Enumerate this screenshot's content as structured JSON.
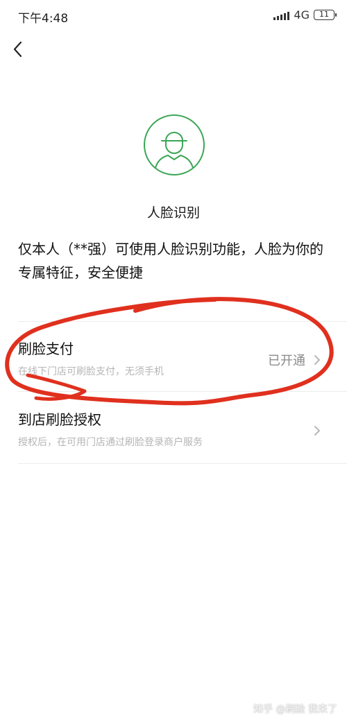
{
  "status_bar": {
    "time": "下午4:48",
    "network": "4G",
    "battery": "11"
  },
  "header": {
    "back_icon": "chevron-left-icon"
  },
  "feature": {
    "title": "人脸识别",
    "avatar_icon": "face-avatar-icon",
    "accent_color": "#3aa655",
    "description": "仅本人（**强）可使用人脸识别功能，人脸为你的专属特征，安全便捷"
  },
  "items": [
    {
      "title": "刷脸支付",
      "subtitle": "在线下门店可刷脸支付，无须手机",
      "status": "已开通"
    },
    {
      "title": "到店刷脸授权",
      "subtitle": "授权后，在可用门店通过刷脸登录商户服务",
      "status": ""
    }
  ],
  "annotation_color": "#e0301e",
  "watermark": "知乎 @刷脸 我来了"
}
